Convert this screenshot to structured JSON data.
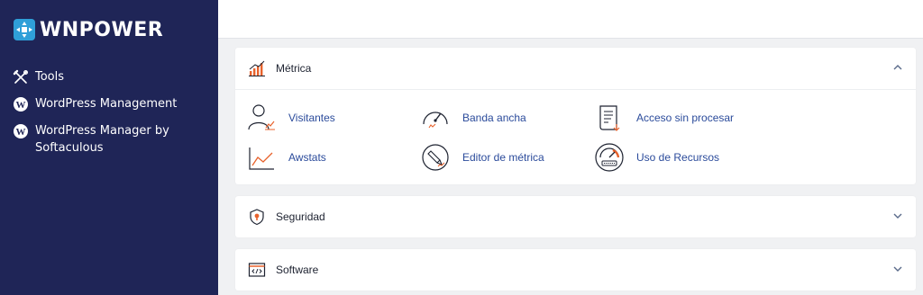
{
  "brand": {
    "name": "WNPOWER"
  },
  "sidebar": {
    "items": [
      {
        "label": "Tools",
        "icon": "tools-icon"
      },
      {
        "label": "WordPress Management",
        "icon": "wordpress-icon"
      },
      {
        "label": "WordPress Manager by Softaculous",
        "icon": "wordpress-icon"
      }
    ]
  },
  "panels": {
    "metrica": {
      "title": "Métrica",
      "expanded": true,
      "tools": [
        {
          "label": "Visitantes",
          "icon": "visitors-icon"
        },
        {
          "label": "Banda ancha",
          "icon": "bandwidth-gauge-icon"
        },
        {
          "label": "Acceso sin procesar",
          "icon": "raw-access-icon"
        },
        {
          "label": "Awstats",
          "icon": "awstats-chart-icon"
        },
        {
          "label": "Editor de métrica",
          "icon": "metrics-editor-icon"
        },
        {
          "label": "Uso de Recursos",
          "icon": "resource-usage-icon"
        }
      ]
    },
    "seguridad": {
      "title": "Seguridad",
      "expanded": false
    },
    "software": {
      "title": "Software",
      "expanded": false
    }
  },
  "colors": {
    "sidebar_bg": "#1f2557",
    "link": "#2b4b9b",
    "accent_orange": "#e8622c",
    "logo_blue": "#2f9fd8"
  }
}
